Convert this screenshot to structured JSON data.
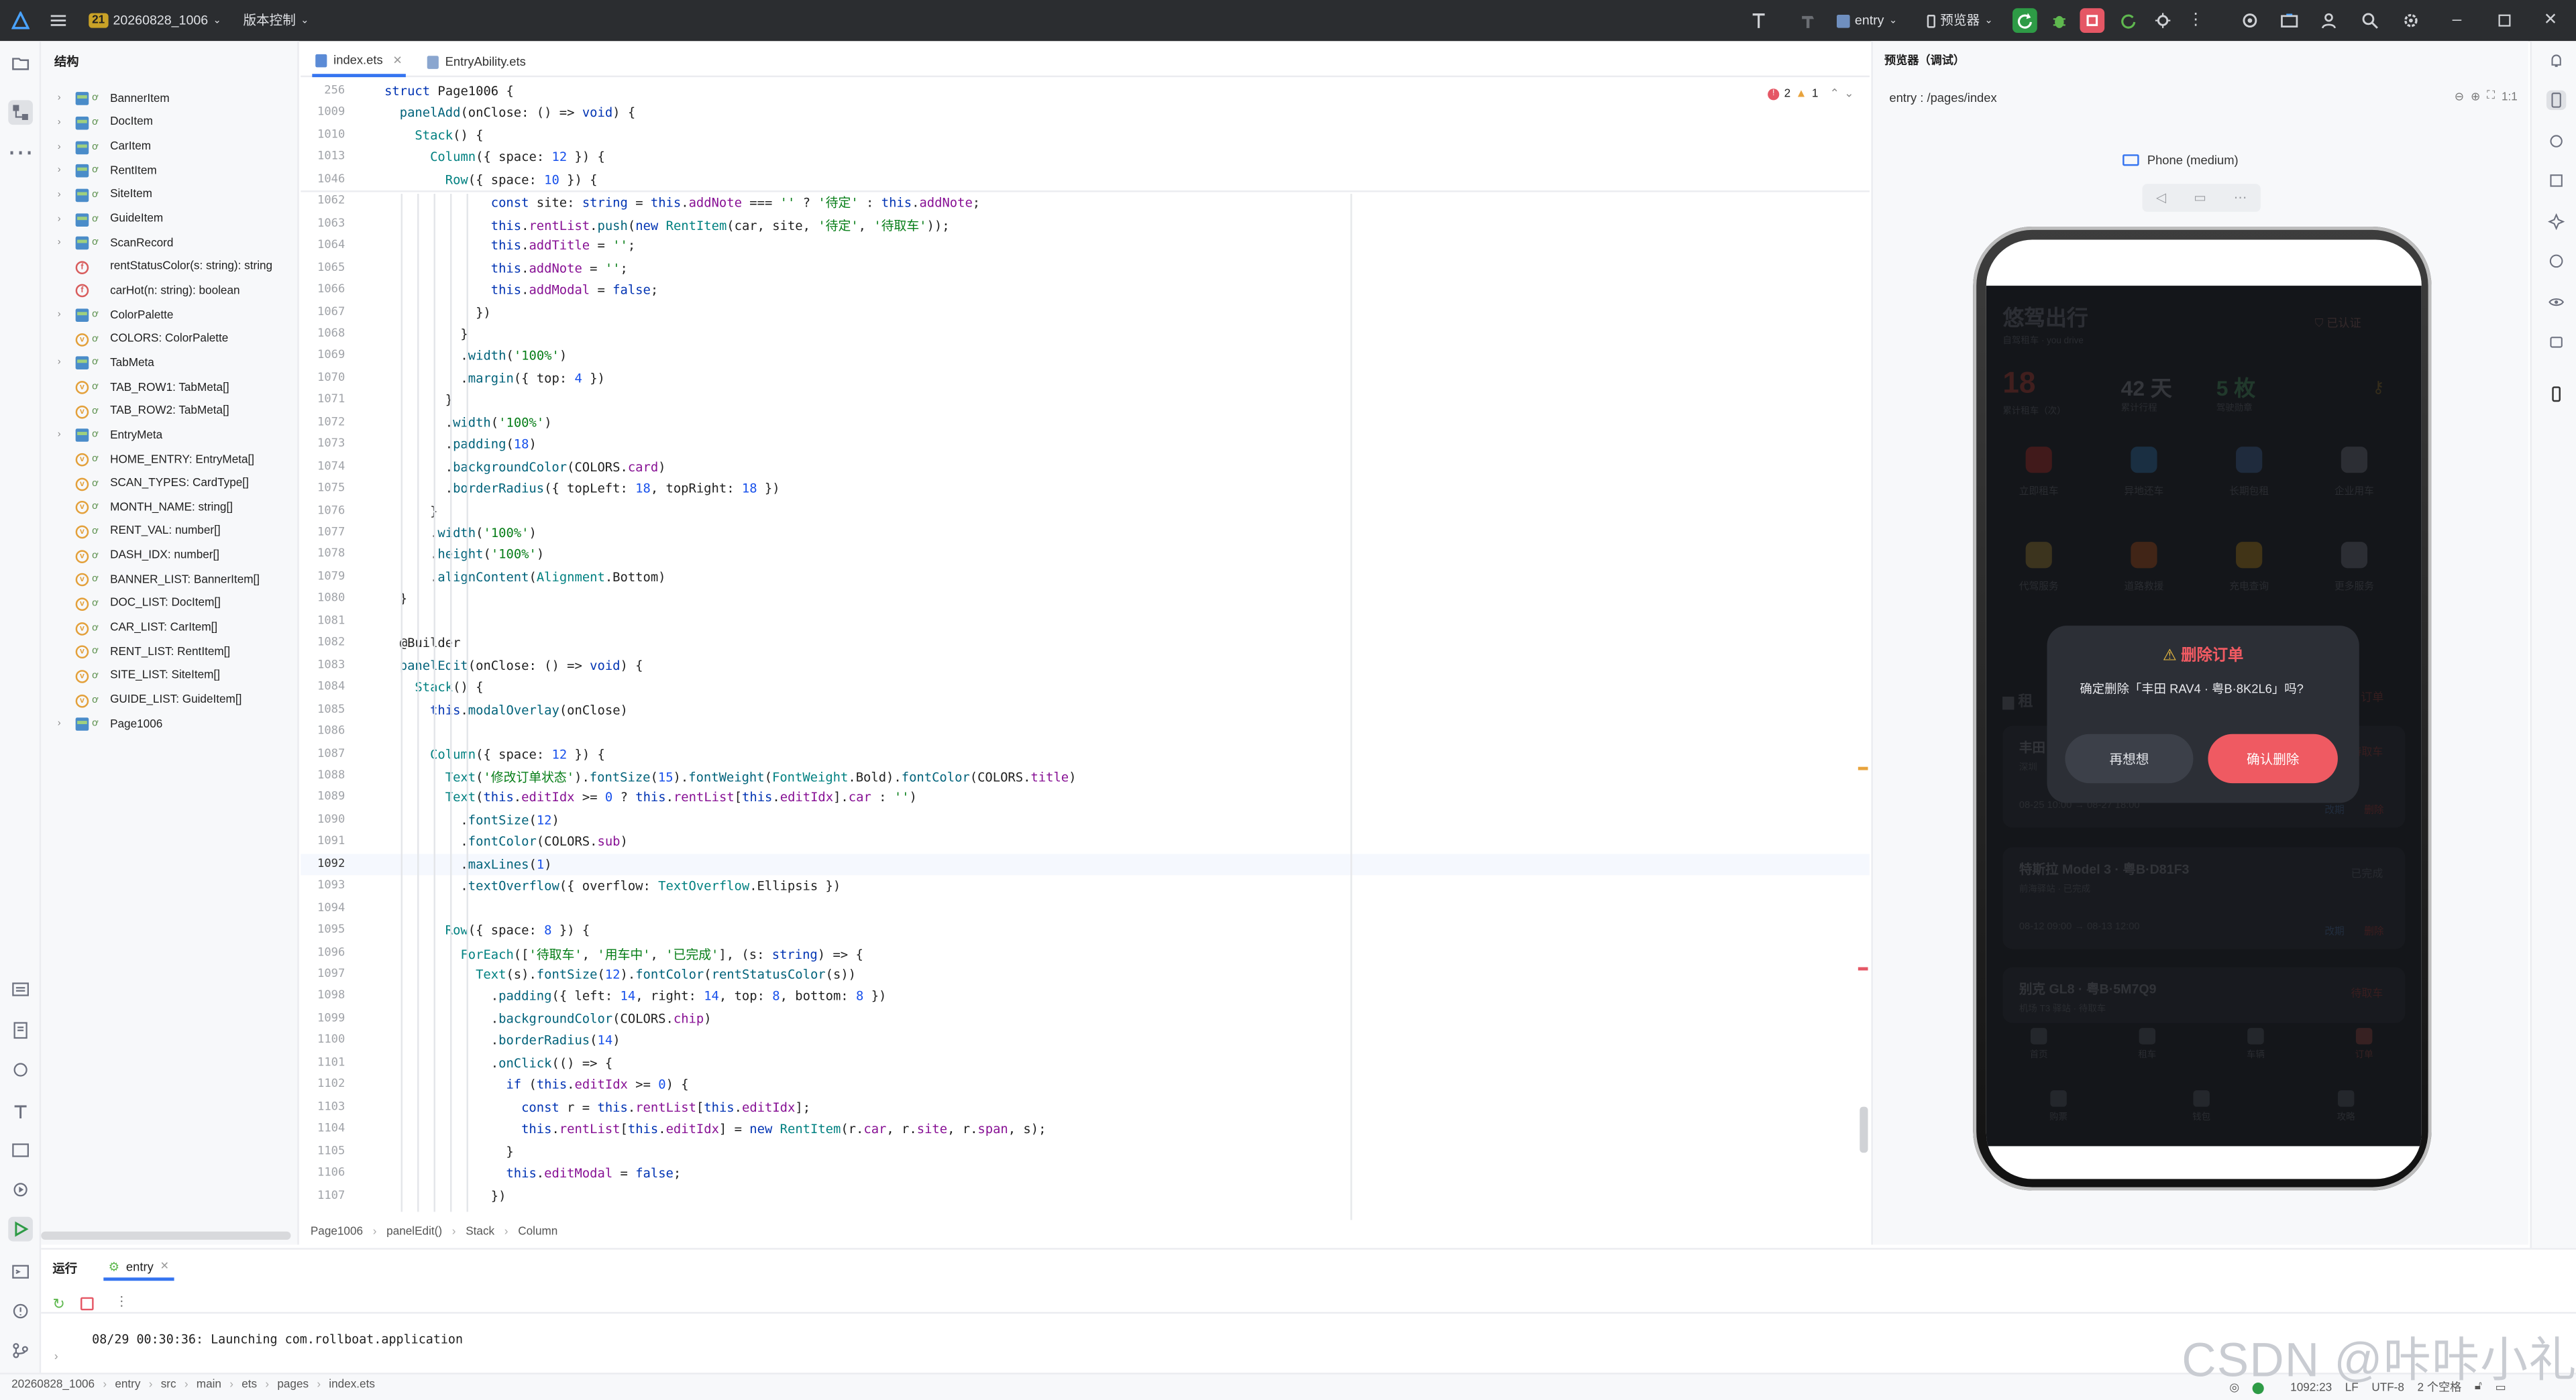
{
  "topbar": {
    "project_badge": "21",
    "project_name": "20260828_1006",
    "vcs_label": "版本控制",
    "run_config": "entry",
    "device": "预览器"
  },
  "structure_panel": {
    "title": "结构",
    "items": [
      {
        "label": "BannerItem",
        "kind": "class",
        "expandable": true
      },
      {
        "label": "DocItem",
        "kind": "class",
        "expandable": true
      },
      {
        "label": "CarItem",
        "kind": "class",
        "expandable": true
      },
      {
        "label": "RentItem",
        "kind": "class",
        "expandable": true
      },
      {
        "label": "SiteItem",
        "kind": "class",
        "expandable": true
      },
      {
        "label": "GuideItem",
        "kind": "class",
        "expandable": true
      },
      {
        "label": "ScanRecord",
        "kind": "class",
        "expandable": true
      },
      {
        "label": "rentStatusColor(s: string): string",
        "kind": "function",
        "expandable": false
      },
      {
        "label": "carHot(n: string): boolean",
        "kind": "function",
        "expandable": false
      },
      {
        "label": "ColorPalette",
        "kind": "class",
        "expandable": true
      },
      {
        "label": "COLORS: ColorPalette",
        "kind": "variable",
        "expandable": false
      },
      {
        "label": "TabMeta",
        "kind": "class",
        "expandable": true
      },
      {
        "label": "TAB_ROW1: TabMeta[]",
        "kind": "variable",
        "expandable": false
      },
      {
        "label": "TAB_ROW2: TabMeta[]",
        "kind": "variable",
        "expandable": false
      },
      {
        "label": "EntryMeta",
        "kind": "class",
        "expandable": true
      },
      {
        "label": "HOME_ENTRY: EntryMeta[]",
        "kind": "variable",
        "expandable": false
      },
      {
        "label": "SCAN_TYPES: CardType[]",
        "kind": "variable",
        "expandable": false
      },
      {
        "label": "MONTH_NAME: string[]",
        "kind": "variable",
        "expandable": false
      },
      {
        "label": "RENT_VAL: number[]",
        "kind": "variable",
        "expandable": false
      },
      {
        "label": "DASH_IDX: number[]",
        "kind": "variable",
        "expandable": false
      },
      {
        "label": "BANNER_LIST: BannerItem[]",
        "kind": "variable",
        "expandable": false
      },
      {
        "label": "DOC_LIST: DocItem[]",
        "kind": "variable",
        "expandable": false
      },
      {
        "label": "CAR_LIST: CarItem[]",
        "kind": "variable",
        "expandable": false
      },
      {
        "label": "RENT_LIST: RentItem[]",
        "kind": "variable",
        "expandable": false
      },
      {
        "label": "SITE_LIST: SiteItem[]",
        "kind": "variable",
        "expandable": false
      },
      {
        "label": "GUIDE_LIST: GuideItem[]",
        "kind": "variable",
        "expandable": false
      },
      {
        "label": "Page1006",
        "kind": "class",
        "expandable": true
      }
    ]
  },
  "editor": {
    "tabs": [
      {
        "label": "index.ets",
        "active": true
      },
      {
        "label": "EntryAbility.ets",
        "active": false
      }
    ],
    "inspections": {
      "errors": "2",
      "warnings": "1"
    },
    "sticky_lines": [
      {
        "num": "256",
        "code": "struct Page1006 {"
      },
      {
        "num": "1009",
        "code": "  panelAdd(onClose: () => void) {"
      },
      {
        "num": "1010",
        "code": "    Stack() {"
      },
      {
        "num": "1013",
        "code": "      Column({ space: 12 }) {"
      },
      {
        "num": "1046",
        "code": "        Row({ space: 10 }) {"
      }
    ],
    "lines": [
      {
        "num": "1062",
        "code": "              const site: string = this.addNote === '' ? '待定' : this.addNote;"
      },
      {
        "num": "1063",
        "code": "              this.rentList.push(new RentItem(car, site, '待定', '待取车'));"
      },
      {
        "num": "1064",
        "code": "              this.addTitle = '';"
      },
      {
        "num": "1065",
        "code": "              this.addNote = '';"
      },
      {
        "num": "1066",
        "code": "              this.addModal = false;"
      },
      {
        "num": "1067",
        "code": "            })"
      },
      {
        "num": "1068",
        "code": "          }"
      },
      {
        "num": "1069",
        "code": "          .width('100%')"
      },
      {
        "num": "1070",
        "code": "          .margin({ top: 4 })"
      },
      {
        "num": "1071",
        "code": "        }"
      },
      {
        "num": "1072",
        "code": "        .width('100%')"
      },
      {
        "num": "1073",
        "code": "        .padding(18)"
      },
      {
        "num": "1074",
        "code": "        .backgroundColor(COLORS.card)"
      },
      {
        "num": "1075",
        "code": "        .borderRadius({ topLeft: 18, topRight: 18 })"
      },
      {
        "num": "1076",
        "code": "      }"
      },
      {
        "num": "1077",
        "code": "      .width('100%')"
      },
      {
        "num": "1078",
        "code": "      .height('100%')"
      },
      {
        "num": "1079",
        "code": "      .alignContent(Alignment.Bottom)"
      },
      {
        "num": "1080",
        "code": "  }"
      },
      {
        "num": "1081",
        "code": ""
      },
      {
        "num": "1082",
        "code": "  @Builder"
      },
      {
        "num": "1083",
        "code": "  panelEdit(onClose: () => void) {"
      },
      {
        "num": "1084",
        "code": "    Stack() {"
      },
      {
        "num": "1085",
        "code": "      this.modalOverlay(onClose)"
      },
      {
        "num": "1086",
        "code": ""
      },
      {
        "num": "1087",
        "code": "      Column({ space: 12 }) {"
      },
      {
        "num": "1088",
        "code": "        Text('修改订单状态').fontSize(15).fontWeight(FontWeight.Bold).fontColor(COLORS.title)"
      },
      {
        "num": "1089",
        "code": "        Text(this.editIdx >= 0 ? this.rentList[this.editIdx].car : '')"
      },
      {
        "num": "1090",
        "code": "          .fontSize(12)"
      },
      {
        "num": "1091",
        "code": "          .fontColor(COLORS.sub)"
      },
      {
        "num": "1092",
        "code": "          .maxLines(1)"
      },
      {
        "num": "1093",
        "code": "          .textOverflow({ overflow: TextOverflow.Ellipsis })"
      },
      {
        "num": "1094",
        "code": ""
      },
      {
        "num": "1095",
        "code": "        Row({ space: 8 }) {"
      },
      {
        "num": "1096",
        "code": "          ForEach(['待取车', '用车中', '已完成'], (s: string) => {"
      },
      {
        "num": "1097",
        "code": "            Text(s).fontSize(12).fontColor(rentStatusColor(s))"
      },
      {
        "num": "1098",
        "code": "              .padding({ left: 14, right: 14, top: 8, bottom: 8 })"
      },
      {
        "num": "1099",
        "code": "              .backgroundColor(COLORS.chip)"
      },
      {
        "num": "1100",
        "code": "              .borderRadius(14)"
      },
      {
        "num": "1101",
        "code": "              .onClick(() => {"
      },
      {
        "num": "1102",
        "code": "                if (this.editIdx >= 0) {"
      },
      {
        "num": "1103",
        "code": "                  const r = this.rentList[this.editIdx];"
      },
      {
        "num": "1104",
        "code": "                  this.rentList[this.editIdx] = new RentItem(r.car, r.site, r.span, s);"
      },
      {
        "num": "1105",
        "code": "                }"
      },
      {
        "num": "1106",
        "code": "                this.editModal = false;"
      },
      {
        "num": "1107",
        "code": "              })"
      }
    ],
    "current_line": "1092",
    "breadcrumb": [
      "Page1006",
      "panelEdit()",
      "Stack",
      "Column"
    ]
  },
  "run_panel": {
    "title": "运行",
    "tab": "entry",
    "log": "08/29 00:30:36: Launching com.rollboat.application"
  },
  "statusbar": {
    "path": [
      "20260828_1006",
      "entry",
      "src",
      "main",
      "ets",
      "pages",
      "index.ets"
    ],
    "position": "1092:23",
    "line_sep": "LF",
    "encoding": "UTF-8",
    "indent": "2 个空格"
  },
  "preview": {
    "title": "预览器（调试）",
    "route": "entry : /pages/index",
    "device_label": "Phone (medium)",
    "zoom_label": "1:1",
    "app": {
      "title": "悠驾出行",
      "subtitle": "自驾租车 · you drive",
      "verified": "已认证",
      "stats": [
        {
          "value": "18",
          "label": "累计租车（次）"
        },
        {
          "value": "42 天",
          "label": "累计行程"
        },
        {
          "value": "5 枚",
          "label": "驾驶勋章"
        }
      ],
      "grid1": [
        "立即租车",
        "异地还车",
        "长期包租",
        "企业用车"
      ],
      "grid2": [
        "代驾服务",
        "道路救援",
        "充电查询",
        "更多服务"
      ],
      "section": "租",
      "section_right": "订单",
      "orders": [
        {
          "title": "丰田",
          "sub": "深圳",
          "time": "08-25 10:00 → 08-27 18:00",
          "status": "待取车",
          "act1": "改期",
          "act2": "删除"
        },
        {
          "title": "特斯拉 Model 3 · 粤B·D81F3",
          "sub": "前海驿站 · 已完成",
          "time": "08-12 09:00 → 08-13 12:00",
          "status": "已完成",
          "act1": "改期",
          "act2": "删除"
        },
        {
          "title": "别克 GL8 · 粤B·5M7Q9",
          "sub": "机场 T3 驿站 · 待取车",
          "time": "",
          "status": "待取车",
          "act1": "",
          "act2": ""
        }
      ],
      "nav1": [
        "首页",
        "租车",
        "车辆",
        "订单"
      ],
      "nav2": [
        "购票",
        "钱包",
        "攻略"
      ]
    },
    "dialog": {
      "title": "删除订单",
      "message": "确定删除「丰田 RAV4 · 粤B·8K2L6」吗?",
      "cancel": "再想想",
      "confirm": "确认删除"
    }
  },
  "watermark": "CSDN @咔咔小礼",
  "colors": {
    "accent": "#3574f0",
    "danger": "#ef5a62",
    "error": "#e55765",
    "warning": "#e8a33d",
    "run_green": "#2e9b46"
  }
}
